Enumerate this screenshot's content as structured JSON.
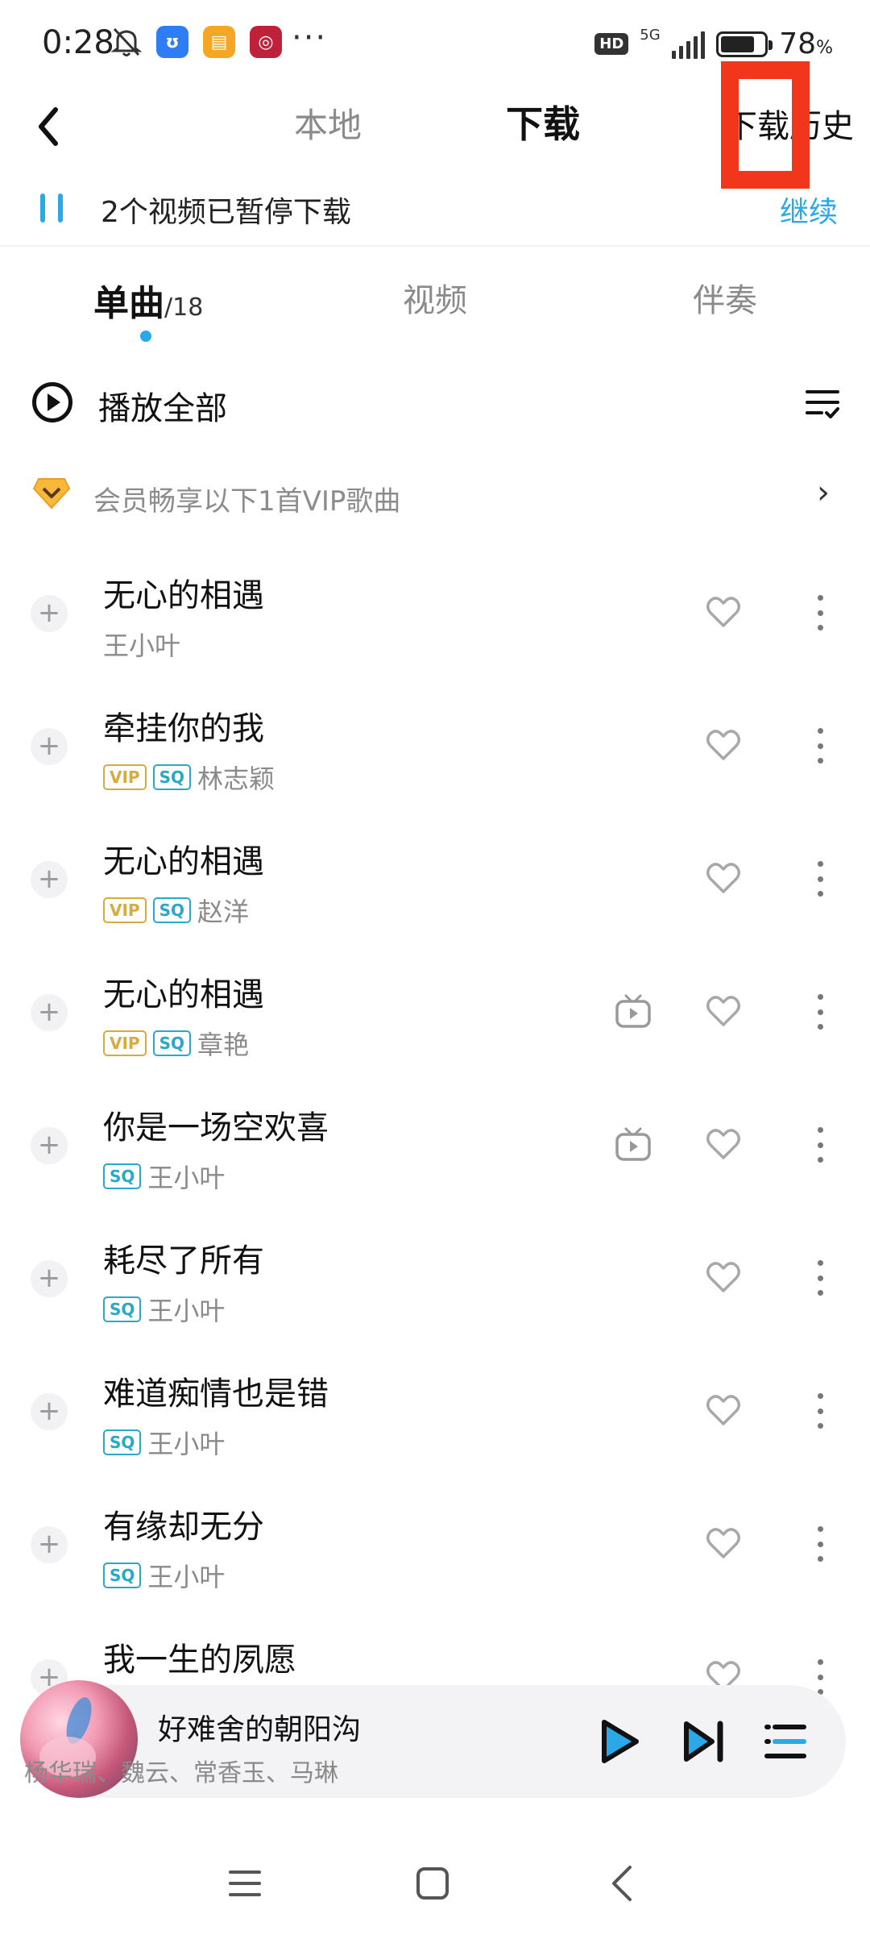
{
  "status_bar": {
    "time": "0:28",
    "network": "5G",
    "hd": "HD",
    "battery_percent": "78",
    "battery_unit": "%",
    "battery_level": 0.78,
    "more_dots": "···",
    "app_badges": [
      {
        "name": "qq-app-icon",
        "color": "#2e7df6",
        "glyph": "ʊ"
      },
      {
        "name": "notes-app-icon",
        "color": "#f5a623",
        "glyph": "▤"
      },
      {
        "name": "bank-app-icon",
        "color": "#c0213a",
        "glyph": "◎"
      }
    ]
  },
  "header": {
    "tab_local": "本地",
    "tab_download": "下载",
    "tab_history": "下载历史",
    "highlight_color": "#f2361c"
  },
  "pause_banner": {
    "text": "2个视频已暂停下载",
    "resume_label": "继续",
    "accent": "#2aa8e8"
  },
  "subtabs": {
    "singles_label": "单曲",
    "singles_count": "/18",
    "videos_label": "视频",
    "accompaniment_label": "伴奏"
  },
  "play_all_label": "播放全部",
  "vip_banner": {
    "text": "会员畅享以下1首VIP歌曲"
  },
  "badges": {
    "vip": "VIP",
    "sq": "SQ"
  },
  "songs": [
    {
      "title": "无心的相遇",
      "artist": "王小叶",
      "vip": false,
      "sq": false,
      "mv": false
    },
    {
      "title": "牵挂你的我",
      "artist": "林志颖",
      "vip": true,
      "sq": true,
      "mv": false
    },
    {
      "title": "无心的相遇",
      "artist": "赵洋",
      "vip": true,
      "sq": true,
      "mv": false
    },
    {
      "title": "无心的相遇",
      "artist": "章艳",
      "vip": true,
      "sq": true,
      "mv": true
    },
    {
      "title": "你是一场空欢喜",
      "artist": "王小叶",
      "vip": false,
      "sq": true,
      "mv": true
    },
    {
      "title": "耗尽了所有",
      "artist": "王小叶",
      "vip": false,
      "sq": true,
      "mv": false
    },
    {
      "title": "难道痴情也是错",
      "artist": "王小叶",
      "vip": false,
      "sq": true,
      "mv": false
    },
    {
      "title": "有缘却无分",
      "artist": "王小叶",
      "vip": false,
      "sq": true,
      "mv": false
    },
    {
      "title": "我一生的夙愿",
      "artist": "",
      "vip": false,
      "sq": false,
      "mv": false
    }
  ],
  "now_playing": {
    "title": "好难舍的朝阳沟",
    "artist": "杨华瑞、魏云、常香玉、马琳"
  }
}
